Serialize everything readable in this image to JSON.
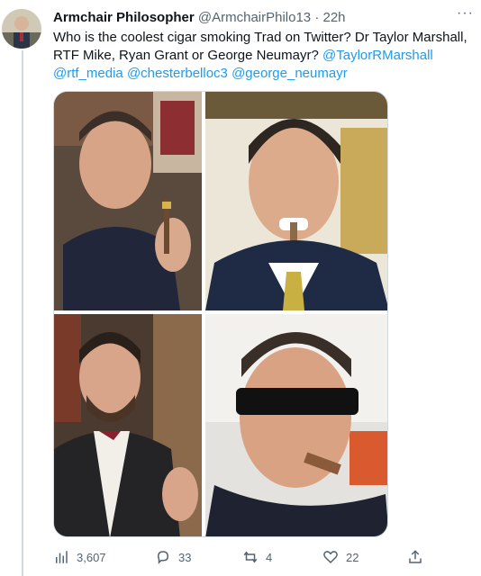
{
  "tweet": {
    "display_name": "Armchair Philosopher",
    "handle": "@ArmchairPhilo13",
    "separator": "·",
    "time": "22h",
    "more_label": "···",
    "text_part1": "Who is the coolest cigar smoking Trad on Twitter? Dr Taylor Marshall, RTF Mike, Ryan Grant or George Neumayr? ",
    "mention1": "@TaylorRMarshall",
    "mention2": "@rtf_media",
    "mention3": "@chesterbelloc3",
    "mention4": "@george_neumayr"
  },
  "actions": {
    "views": "3,607",
    "replies": "33",
    "retweets": "4",
    "likes": "22"
  },
  "colors": {
    "link": "#1d9bf0",
    "muted": "#536471",
    "border": "#cfd9de"
  },
  "icons": [
    "analytics-icon",
    "reply-icon",
    "retweet-icon",
    "like-icon",
    "share-icon",
    "more-icon"
  ]
}
